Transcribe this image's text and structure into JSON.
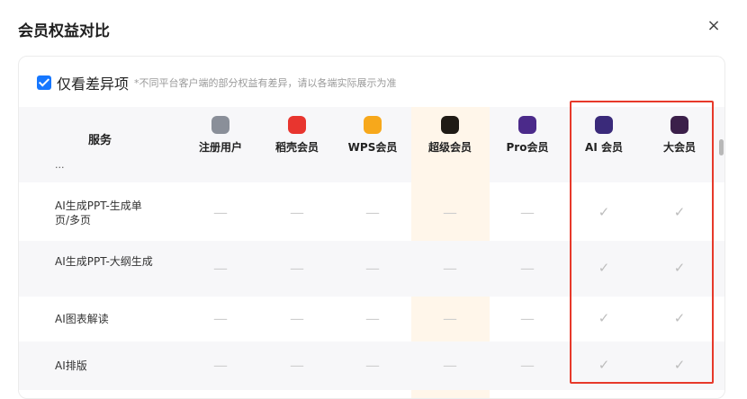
{
  "dialog": {
    "title": "会员权益对比",
    "close_glyph": "×"
  },
  "filter": {
    "label": "仅看差异项",
    "note": "*不同平台客户端的部分权益有差异，请以各端实际展示为准"
  },
  "table": {
    "service_header": "服务",
    "columns": [
      {
        "label": "注册用户",
        "icon": "user-icon",
        "color": "#8a8f99"
      },
      {
        "label": "稻壳会员",
        "icon": "docer-icon",
        "color": "#e8352f"
      },
      {
        "label": "WPS会员",
        "icon": "crown-icon",
        "color": "#f7a81b"
      },
      {
        "label": "超级会员",
        "icon": "super-member-icon",
        "color": "#1f1a14"
      },
      {
        "label": "Pro会员",
        "icon": "pro-member-icon",
        "color": "#4b2a8a"
      },
      {
        "label": "AI 会员",
        "icon": "ai-member-icon",
        "color": "#3a2a7a"
      },
      {
        "label": "大会员",
        "icon": "big-member-icon",
        "color": "#3b1f4a"
      }
    ],
    "partial_row_text": "...",
    "rows": [
      {
        "label": "AI生成PPT-生成单页/多页",
        "values": [
          "—",
          "—",
          "—",
          "—",
          "—",
          "✓",
          "✓"
        ]
      },
      {
        "label": "AI生成PPT-大纲生成",
        "values": [
          "—",
          "—",
          "—",
          "—",
          "—",
          "✓",
          "✓"
        ]
      },
      {
        "label": "AI图表解读",
        "values": [
          "—",
          "—",
          "—",
          "—",
          "—",
          "✓",
          "✓"
        ]
      },
      {
        "label": "AI排版",
        "values": [
          "—",
          "—",
          "—",
          "—",
          "—",
          "✓",
          "✓"
        ]
      }
    ]
  }
}
